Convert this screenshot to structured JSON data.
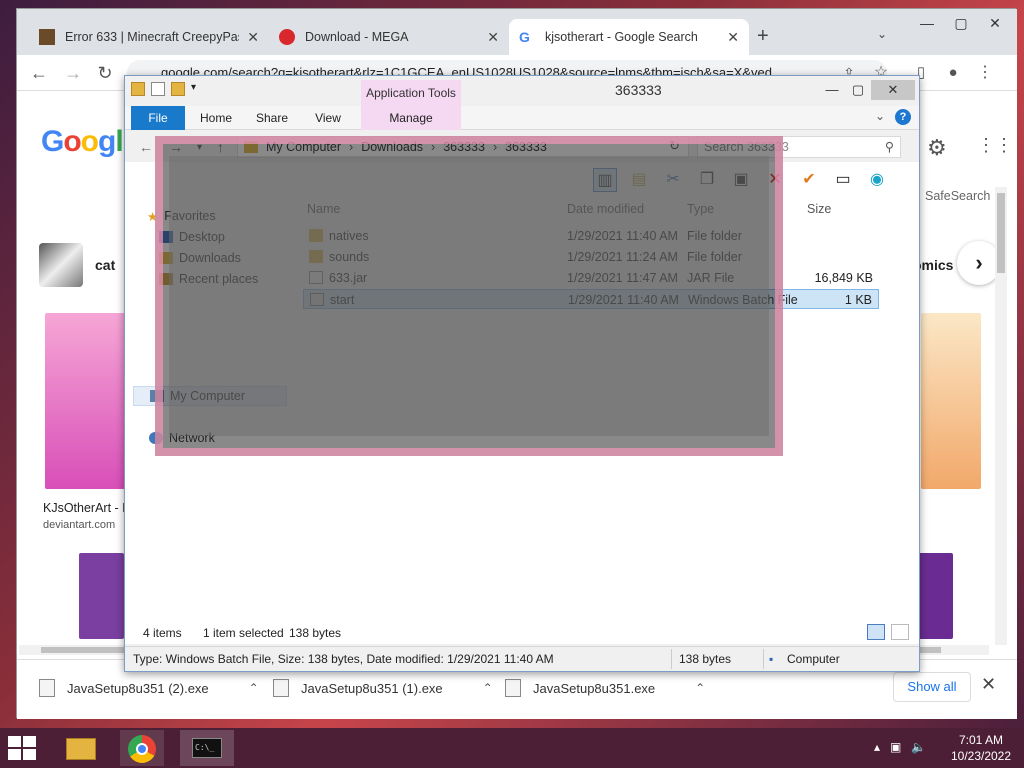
{
  "browser": {
    "tabs": [
      {
        "title": "Error 633 | Minecraft CreepyPasta",
        "active": false
      },
      {
        "title": "Download - MEGA",
        "active": false
      },
      {
        "title": "kjsotherart - Google Search",
        "active": true
      }
    ],
    "new_tab": "+",
    "tab_list": "⌄",
    "address": "google.com/search?q=kjsotherart&rlz=1C1GCEA_enUS1028US1028&source=lnms&tbm=isch&sa=X&ved"
  },
  "google": {
    "safesearch": "SafeSearch",
    "chip_cat": "cat",
    "chip_comics": "omics",
    "result1_title": "KJsOtherArt - I",
    "result1_source": "deviantart.com"
  },
  "downloads": {
    "items": [
      "JavaSetup8u351 (2).exe",
      "JavaSetup8u351 (1).exe",
      "JavaSetup8u351.exe"
    ],
    "show_all": "Show all"
  },
  "explorer": {
    "title": "363333",
    "app_tools": "Application Tools",
    "ribbon_tabs": {
      "file": "File",
      "home": "Home",
      "share": "Share",
      "view": "View",
      "manage": "Manage"
    },
    "breadcrumb": [
      "My Computer",
      "Downloads",
      "363333",
      "363333"
    ],
    "search_placeholder": "Search 363333",
    "nav": {
      "favorites": "Favorites",
      "desktop": "Desktop",
      "downloads": "Downloads",
      "recent": "Recent places",
      "my_computer": "My Computer",
      "network": "Network"
    },
    "columns": {
      "name": "Name",
      "date": "Date modified",
      "type": "Type",
      "size": "Size"
    },
    "files": [
      {
        "name": "natives",
        "date": "1/29/2021 11:40 AM",
        "type": "File folder",
        "size": ""
      },
      {
        "name": "sounds",
        "date": "1/29/2021 11:24 AM",
        "type": "File folder",
        "size": ""
      },
      {
        "name": "633.jar",
        "date": "1/29/2021 11:47 AM",
        "type": "JAR File",
        "size": "16,849 KB"
      },
      {
        "name": "start",
        "date": "1/29/2021 11:40 AM",
        "type": "Windows Batch File",
        "size": "1 KB"
      }
    ],
    "status": {
      "items": "4 items",
      "selected": "1 item selected",
      "bytes": "138 bytes"
    },
    "statusbar": {
      "details": "Type: Windows Batch File, Size: 138 bytes, Date modified: 1/29/2021 11:40 AM",
      "size": "138 bytes",
      "location": "Computer"
    }
  },
  "taskbar": {
    "time": "7:01 AM",
    "date": "10/23/2022"
  },
  "colors": {
    "accent": "#1979ca",
    "app_tools": "#f5d8f2",
    "selection": "#cde4f7",
    "taskbar": "#4c1f36"
  }
}
